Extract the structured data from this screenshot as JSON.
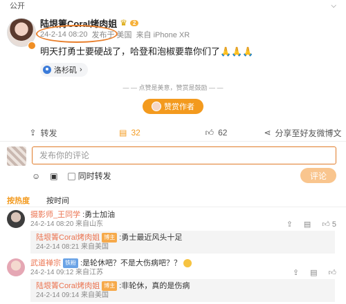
{
  "topbar": {
    "visibility": "公开",
    "chevron_icon": "chevron-down-icon"
  },
  "post": {
    "author": "陆垠箐Coral烤肉姐",
    "level_badge": "2",
    "timestamp": "24-2-14 08:20",
    "published_in": "发布于 美国",
    "device": "来自 iPhone XR",
    "content": "明天打勇士要硬战了，哈登和泡椒要靠你们了🙏🙏🙏",
    "location": "洛杉矶",
    "colors": {
      "accent": "#f39a1e",
      "ring": "#e87e2b",
      "username": "#eb7350"
    }
  },
  "reward": {
    "hint": "点赞是美意，赞赏是鼓励",
    "button_label": "赞赏作者"
  },
  "actions": [
    {
      "label": "转发",
      "icon": "share-icon"
    },
    {
      "label": "32",
      "icon": "comment-icon"
    },
    {
      "label": "62",
      "icon": "thumbs-up-icon"
    },
    {
      "label": "分享至好友微博文",
      "icon": "share-nodes-icon"
    }
  ],
  "composer": {
    "placeholder": "发布你的评论",
    "emoji_icon": "emoji-icon",
    "image_icon": "image-icon",
    "repost_label": "同时转发",
    "send_label": "评论"
  },
  "sort": {
    "hot": "按热度",
    "time": "按时间"
  },
  "comments": [
    {
      "user": "摄影师_王同学",
      "text": ":勇士加油",
      "meta": "24-2-14 08:20 来自山东",
      "likes": "5",
      "reply": {
        "user": "陆垠箐Coral烤肉姐",
        "badge": "博主",
        "text": ":勇士最近风头十足",
        "meta": "24-2-14 08:21 来自美国"
      }
    },
    {
      "user": "武道禅宗",
      "badge": "铁粉",
      "text": ":是轮休吧？不是大伤病吧？？",
      "meta": "24-2-14 09:12 来自江苏",
      "likes": "",
      "reply": {
        "user": "陆垠箐Coral烤肉姐",
        "badge": "博主",
        "text": ":非轮休，真的是伤病",
        "meta": "24-2-14 09:14 来自美国"
      }
    }
  ]
}
